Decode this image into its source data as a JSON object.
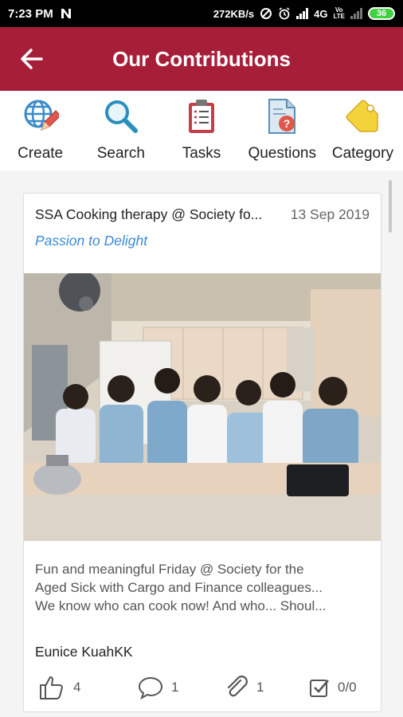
{
  "status_bar": {
    "time": "7:23 PM",
    "network_speed": "272KB/s",
    "network_type": "4G",
    "battery": "36"
  },
  "app_bar": {
    "title": "Our Contributions",
    "back_icon": "arrow-left-icon"
  },
  "actions": [
    {
      "label": "Create",
      "icon": "globe-pencil-icon"
    },
    {
      "label": "Search",
      "icon": "magnifier-icon"
    },
    {
      "label": "Tasks",
      "icon": "clipboard-icon"
    },
    {
      "label": "Questions",
      "icon": "question-document-icon"
    },
    {
      "label": "Category",
      "icon": "tag-icon"
    }
  ],
  "post": {
    "title": "SSA Cooking therapy @ Society fo...",
    "date": "13 Sep 2019",
    "subtitle": "Passion to Delight",
    "description_lines": [
      "Fun and meaningful Friday @ Society for the",
      "Aged Sick with Cargo and Finance colleagues...",
      "We know who can cook now! And who... Shoul..."
    ],
    "author": "Eunice KuahKK",
    "likes": "4",
    "comments": "1",
    "attachments": "1",
    "checklist": "0/0"
  },
  "colors": {
    "app_bar": "#a71e38",
    "subtitle": "#3b8ad6"
  }
}
